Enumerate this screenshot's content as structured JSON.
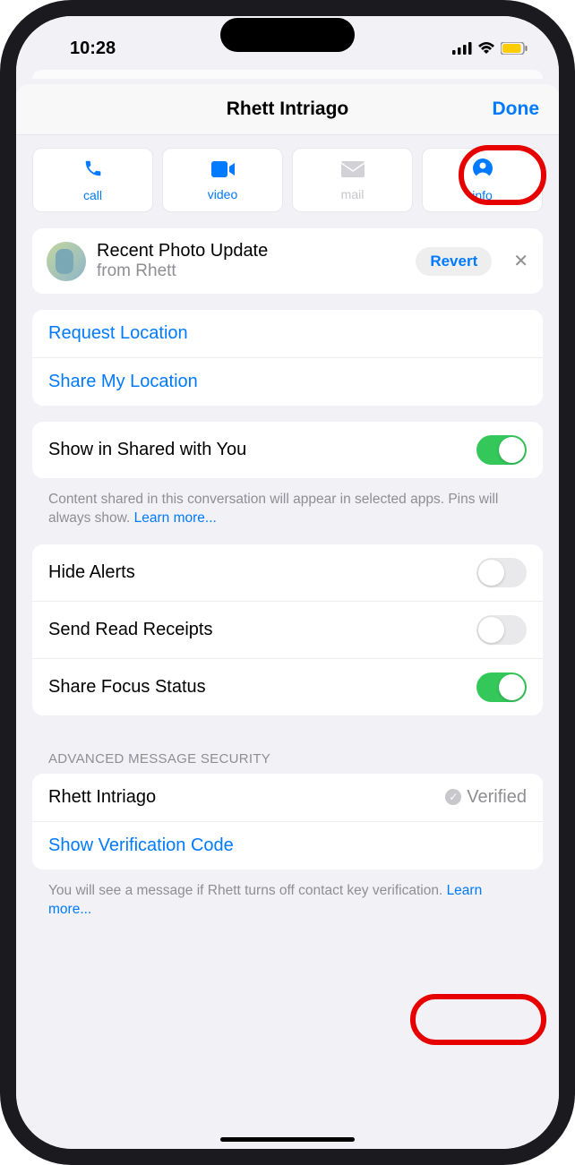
{
  "status": {
    "time": "10:28"
  },
  "header": {
    "title": "Rhett Intriago",
    "done": "Done"
  },
  "actions": {
    "call": "call",
    "video": "video",
    "mail": "mail",
    "info": "info"
  },
  "photoUpdate": {
    "title": "Recent Photo Update",
    "from": "from Rhett",
    "revert": "Revert"
  },
  "location": {
    "request": "Request Location",
    "share": "Share My Location"
  },
  "shared": {
    "label": "Show in Shared with You",
    "footer1": "Content shared in this conversation will appear in selected apps. Pins will always show. ",
    "learn": "Learn more..."
  },
  "notif": {
    "hide": "Hide Alerts",
    "receipts": "Send Read Receipts",
    "focus": "Share Focus Status"
  },
  "security": {
    "header": "ADVANCED MESSAGE SECURITY",
    "name": "Rhett Intriago",
    "verified": "Verified",
    "showCode": "Show Verification Code",
    "footer1": "You will see a message if Rhett turns off contact key verification. ",
    "learn": "Learn more..."
  }
}
